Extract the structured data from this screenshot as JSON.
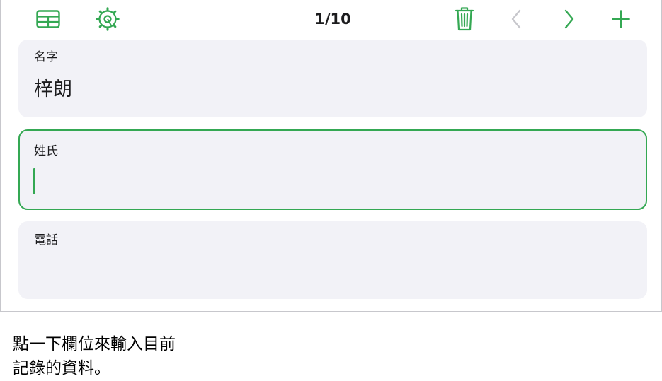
{
  "toolbar": {
    "table_icon": "table-grid-icon",
    "settings_icon": "gear-settings-icon",
    "record_counter": "1/10",
    "delete_icon": "trash-icon",
    "prev_icon": "chevron-left-icon",
    "next_icon": "chevron-right-icon",
    "add_icon": "plus-icon"
  },
  "fields": {
    "first_name": {
      "label": "名字",
      "value": "梓朗"
    },
    "last_name": {
      "label": "姓氏",
      "value": ""
    },
    "phone": {
      "label": "電話",
      "value": ""
    }
  },
  "callout": {
    "line1": "點一下欄位來輸入目前",
    "line2": "記錄的資料。"
  },
  "colors": {
    "accent": "#34a853",
    "field_background": "#f2f2f7",
    "disabled_icon": "#c7c7cc"
  }
}
